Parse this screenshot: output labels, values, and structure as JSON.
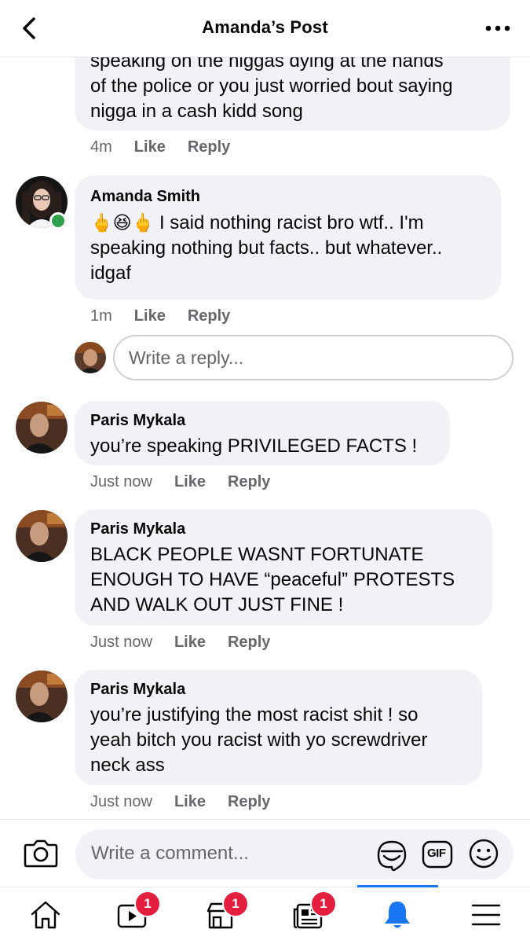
{
  "header": {
    "title": "Amanda’s Post"
  },
  "comments": [
    {
      "text": "speaking on the niggas dying at the hands of the police or you just worried bout saying nigga in a cash kidd song",
      "line1": "speaking on the niggas dying at the hands",
      "line2": "of the police or you just worried bout saying",
      "line3": "nigga in a cash kidd song",
      "time": "4m",
      "like": "Like",
      "reply": "Reply"
    },
    {
      "author": "Amanda Smith",
      "emoji": "🖕😆🖕",
      "line1": "I said nothing racist bro wtf.. I'm",
      "line2": "speaking nothing but facts.. but whatever..",
      "line3": "idgaf",
      "time": "1m",
      "like": "Like",
      "reply": "Reply"
    },
    {
      "author": "Paris Mykala",
      "line1": "you’re speaking PRIVILEGED FACTS !",
      "time": "Just now",
      "like": "Like",
      "reply": "Reply"
    },
    {
      "author": "Paris Mykala",
      "line1": "BLACK PEOPLE WASNT FORTUNATE",
      "line2": "ENOUGH TO HAVE “peaceful” PROTESTS",
      "line3": "AND WALK OUT JUST FINE !",
      "time": "Just now",
      "like": "Like",
      "reply": "Reply"
    },
    {
      "author": "Paris Mykala",
      "line1": "you’re justifying the most racist shit ! so",
      "line2": "yeah bitch you racist with yo screwdriver",
      "line3": "neck ass",
      "time": "Just now",
      "like": "Like",
      "reply": "Reply"
    }
  ],
  "reply_box": {
    "placeholder": "Write a reply..."
  },
  "composer": {
    "placeholder": "Write a comment...",
    "gif_label": "GIF"
  },
  "tabbar": {
    "tabs": [
      {
        "name": "home",
        "badge": ""
      },
      {
        "name": "watch",
        "badge": "1"
      },
      {
        "name": "marketplace",
        "badge": "1"
      },
      {
        "name": "news",
        "badge": "1"
      },
      {
        "name": "notifications",
        "badge": "",
        "active": true
      },
      {
        "name": "menu",
        "badge": ""
      }
    ]
  },
  "colors": {
    "accent": "#1877f2",
    "badge": "#e41e3f",
    "bubble": "#f0f2f5",
    "online": "#31a24c"
  }
}
